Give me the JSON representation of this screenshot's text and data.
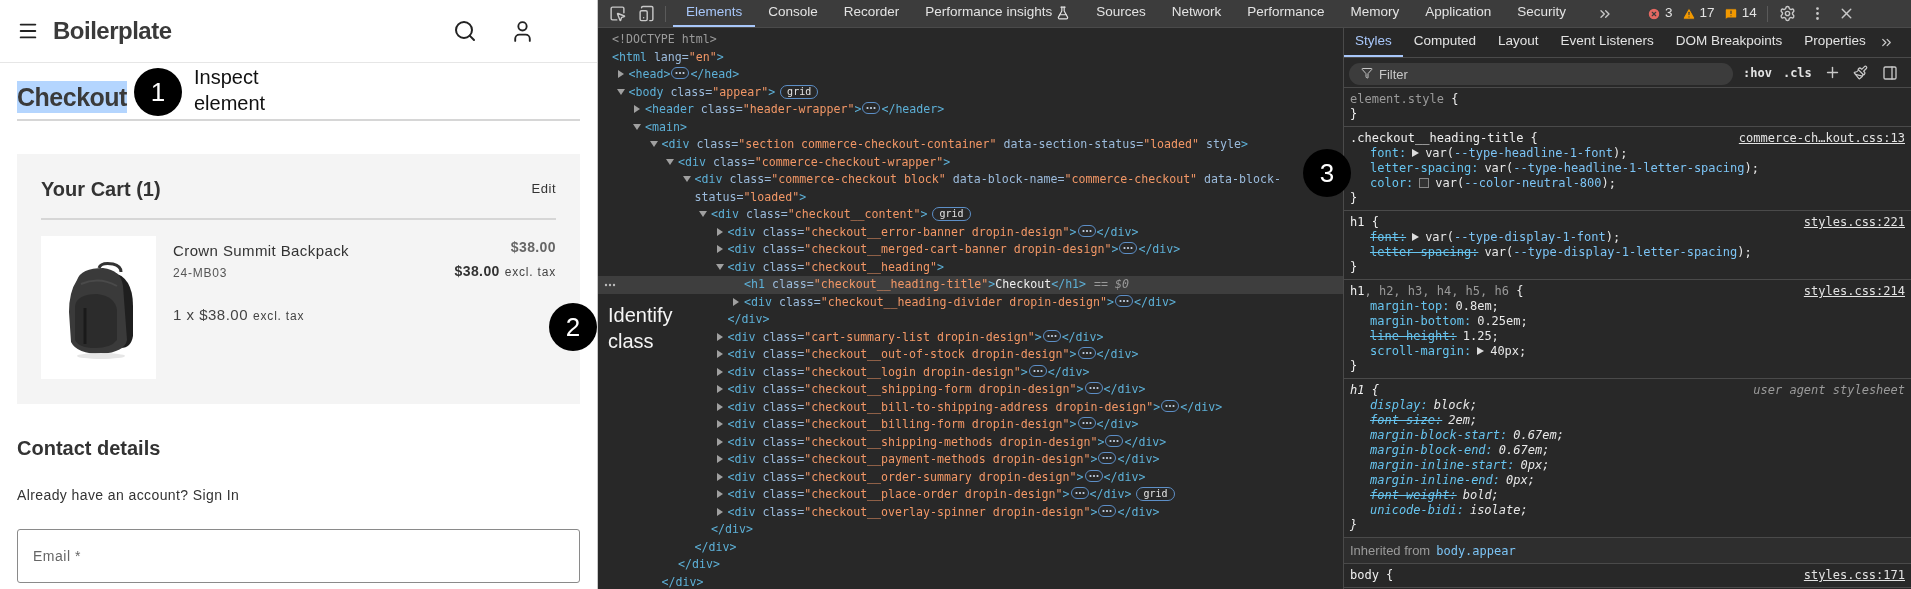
{
  "site": {
    "brand": "Boilerplate"
  },
  "checkout": {
    "title": "Checkout",
    "highlighted": true
  },
  "cart": {
    "title": "Your Cart (1)",
    "edit": "Edit",
    "items": [
      {
        "name": "Crown Summit Backpack",
        "sku": "24-MB03",
        "quantity": "1 x $38.00",
        "quantity_note": "excl. tax",
        "price": "$38.00",
        "price_excl": "$38.00",
        "price_excl_note": "excl. tax"
      }
    ]
  },
  "contact": {
    "title": "Contact details",
    "prompt": "Already have an account? Sign In",
    "email": {
      "placeholder": "Email *"
    }
  },
  "devtools": {
    "tabs": [
      {
        "label": "Elements",
        "selected": true
      },
      {
        "label": "Console",
        "selected": false
      },
      {
        "label": "Recorder",
        "selected": false
      },
      {
        "label": "Performance insights",
        "selected": false,
        "experimental": true
      },
      {
        "label": "Sources",
        "selected": false
      },
      {
        "label": "Network",
        "selected": false
      },
      {
        "label": "Performance",
        "selected": false
      },
      {
        "label": "Memory",
        "selected": false
      },
      {
        "label": "Application",
        "selected": false
      },
      {
        "label": "Security",
        "selected": false
      }
    ],
    "counts": {
      "errors": "3",
      "warnings": "17",
      "issues": "14"
    },
    "tree": [
      {
        "kind": "doctype",
        "text": "<!DOCTYPE html>"
      },
      {
        "kind": "root",
        "open": "<html lang=\"en\">",
        "selected": false,
        "children": [
          {
            "kind": "element",
            "open": "<head>",
            "close": "</head>",
            "expanded": false,
            "selected": false
          },
          {
            "kind": "element",
            "open": "<body class=\"appear\">",
            "badge": "grid",
            "expanded": true,
            "selected": false,
            "children": [
              {
                "kind": "element",
                "open": "<header class=\"header-wrapper\">",
                "close": "</header>",
                "expanded": false,
                "selected": false
              },
              {
                "kind": "element",
                "open": "<main>",
                "expanded": true,
                "selected": false,
                "children": [
                  {
                    "kind": "element",
                    "open": "<div class=\"section commerce-checkout-container\" data-section-status=\"loaded\" style>",
                    "close": "</div>",
                    "expanded": true,
                    "selected": false,
                    "children": [
                      {
                        "kind": "element",
                        "open": "<div class=\"commerce-checkout-wrapper\">",
                        "close": "</div>",
                        "expanded": true,
                        "selected": false,
                        "children": [
                          {
                            "kind": "element",
                            "open": "<div class=\"commerce-checkout block\" data-block-name=\"commerce-checkout\" data-block-status=\"loaded\">",
                            "close": "</div>",
                            "expanded": true,
                            "selected": false,
                            "children": [
                              {
                                "kind": "element",
                                "open": "<div class=\"checkout__content\">",
                                "badge": "grid",
                                "close": "</div>",
                                "expanded": true,
                                "selected": false,
                                "children": [
                                  {
                                    "kind": "element",
                                    "open": "<div class=\"checkout__error-banner dropin-design\">",
                                    "close": "</div>",
                                    "expanded": false,
                                    "selected": false
                                  },
                                  {
                                    "kind": "element",
                                    "open": "<div class=\"checkout__merged-cart-banner dropin-design\">",
                                    "close": "</div>",
                                    "expanded": false,
                                    "selected": false
                                  },
                                  {
                                    "kind": "element",
                                    "open": "<div class=\"checkout__heading\">",
                                    "close": "</div>",
                                    "expanded": true,
                                    "selected": false,
                                    "children": [
                                      {
                                        "kind": "inline",
                                        "open": "<h1 class=\"checkout__heading-title\">",
                                        "text": "Checkout",
                                        "close": "</h1>",
                                        "suffix": "== $0",
                                        "selected": true
                                      },
                                      {
                                        "kind": "element",
                                        "open": "<div class=\"checkout__heading-divider dropin-design\">",
                                        "close": "</div>",
                                        "expanded": false,
                                        "selected": false
                                      }
                                    ]
                                  },
                                  {
                                    "kind": "element",
                                    "open": "<div class=\"cart-summary-list dropin-design\">",
                                    "close": "</div>",
                                    "expanded": false,
                                    "selected": false
                                  },
                                  {
                                    "kind": "element",
                                    "open": "<div class=\"checkout__out-of-stock dropin-design\">",
                                    "close": "</div>",
                                    "expanded": false,
                                    "selected": false
                                  },
                                  {
                                    "kind": "element",
                                    "open": "<div class=\"checkout__login dropin-design\">",
                                    "close": "</div>",
                                    "expanded": false,
                                    "selected": false
                                  },
                                  {
                                    "kind": "element",
                                    "open": "<div class=\"checkout__shipping-form dropin-design\">",
                                    "close": "</div>",
                                    "expanded": false,
                                    "selected": false
                                  },
                                  {
                                    "kind": "element",
                                    "open": "<div class=\"checkout__bill-to-shipping-address dropin-design\">",
                                    "close": "</div>",
                                    "expanded": false,
                                    "selected": false
                                  },
                                  {
                                    "kind": "element",
                                    "open": "<div class=\"checkout__billing-form dropin-design\">",
                                    "close": "</div>",
                                    "expanded": false,
                                    "selected": false
                                  },
                                  {
                                    "kind": "element",
                                    "open": "<div class=\"checkout__shipping-methods dropin-design\">",
                                    "close": "</div>",
                                    "expanded": false,
                                    "selected": false
                                  },
                                  {
                                    "kind": "element",
                                    "open": "<div class=\"checkout__payment-methods dropin-design\">",
                                    "close": "</div>",
                                    "expanded": false,
                                    "selected": false
                                  },
                                  {
                                    "kind": "element",
                                    "open": "<div class=\"checkout__order-summary dropin-design\">",
                                    "close": "</div>",
                                    "expanded": false,
                                    "selected": false
                                  },
                                  {
                                    "kind": "element",
                                    "open": "<div class=\"checkout__place-order dropin-design\">",
                                    "close": "</div>",
                                    "badge": "grid",
                                    "expanded": false,
                                    "selected": false
                                  },
                                  {
                                    "kind": "element",
                                    "open": "<div class=\"checkout__overlay-spinner dropin-design\">",
                                    "close": "</div>",
                                    "expanded": false,
                                    "selected": false
                                  }
                                ]
                              }
                            ]
                          }
                        ]
                      }
                    ]
                  }
                ]
              }
            ]
          }
        ]
      }
    ],
    "styles": {
      "tabs": [
        {
          "label": "Styles",
          "selected": true
        },
        {
          "label": "Computed",
          "selected": false
        },
        {
          "label": "Layout",
          "selected": false
        },
        {
          "label": "Event Listeners",
          "selected": false
        },
        {
          "label": "DOM Breakpoints",
          "selected": false
        },
        {
          "label": "Properties",
          "selected": false
        }
      ],
      "filter": {
        "placeholder": "Filter"
      },
      "hov": ":hov",
      "cls": ".cls",
      "rules": [
        {
          "kind": "rule",
          "selector": [
            {
              "text": "element.style",
              "dim": true
            },
            {
              "text": " {",
              "dim": false
            }
          ],
          "close": "}",
          "italic": false
        },
        {
          "kind": "rule",
          "selector": [
            {
              "text": ".checkout__heading-title {",
              "dim": false
            }
          ],
          "source": "commerce-ch…kout.css:13",
          "source_link": true,
          "close": "}",
          "italic": false,
          "declarations": [
            {
              "property": "font:",
              "value": "var(--type-headline-1-font);",
              "expander": true,
              "swatch": false,
              "struck": false
            },
            {
              "property": "letter-spacing:",
              "value": "var(--type-headline-1-letter-spacing);",
              "expander": false,
              "swatch": false,
              "struck": false
            },
            {
              "property": "color:",
              "value": "var(--color-neutral-800);",
              "expander": false,
              "swatch": true,
              "struck": false
            }
          ]
        },
        {
          "kind": "rule",
          "selector": [
            {
              "text": "h1 {",
              "dim": false
            }
          ],
          "source": "styles.css:221",
          "source_link": true,
          "close": "}",
          "italic": false,
          "declarations": [
            {
              "property": "font:",
              "value": "var(--type-display-1-font);",
              "expander": true,
              "swatch": false,
              "struck": true
            },
            {
              "property": "letter-spacing:",
              "value": "var(--type-display-1-letter-spacing);",
              "expander": false,
              "swatch": false,
              "struck": true
            }
          ]
        },
        {
          "kind": "rule",
          "selector": [
            {
              "text": "h1",
              "dim": false
            },
            {
              "text": ", h2, h3, h4, h5, h6",
              "dim": true
            },
            {
              "text": " {",
              "dim": false
            }
          ],
          "source": "styles.css:214",
          "source_link": true,
          "close": "}",
          "italic": false,
          "declarations": [
            {
              "property": "margin-top:",
              "value": "0.8em;",
              "expander": false,
              "swatch": false,
              "struck": false
            },
            {
              "property": "margin-bottom:",
              "value": "0.25em;",
              "expander": false,
              "swatch": false,
              "struck": false
            },
            {
              "property": "line-height:",
              "value": "1.25;",
              "expander": false,
              "swatch": false,
              "struck": true
            },
            {
              "property": "scroll-margin:",
              "value": "40px;",
              "expander": true,
              "swatch": false,
              "struck": false
            }
          ]
        },
        {
          "kind": "rule",
          "selector": [
            {
              "text": "h1 {",
              "dim": false
            }
          ],
          "source": "user agent stylesheet",
          "source_link": false,
          "close": "}",
          "italic": true,
          "declarations": [
            {
              "property": "display:",
              "value": "block;",
              "expander": false,
              "swatch": false,
              "struck": false
            },
            {
              "property": "font-size:",
              "value": "2em;",
              "expander": false,
              "swatch": false,
              "struck": true
            },
            {
              "property": "margin-block-start:",
              "value": "0.67em;",
              "expander": false,
              "swatch": false,
              "struck": false
            },
            {
              "property": "margin-block-end:",
              "value": "0.67em;",
              "expander": false,
              "swatch": false,
              "struck": false
            },
            {
              "property": "margin-inline-start:",
              "value": "0px;",
              "expander": false,
              "swatch": false,
              "struck": false
            },
            {
              "property": "margin-inline-end:",
              "value": "0px;",
              "expander": false,
              "swatch": false,
              "struck": false
            },
            {
              "property": "font-weight:",
              "value": "bold;",
              "expander": false,
              "swatch": false,
              "struck": true
            },
            {
              "property": "unicode-bidi:",
              "value": "isolate;",
              "expander": false,
              "swatch": false,
              "struck": false
            }
          ]
        },
        {
          "kind": "inherited",
          "label": "Inherited from",
          "link": "body.appear"
        },
        {
          "kind": "rule",
          "selector": [
            {
              "text": "body {",
              "dim": false
            }
          ],
          "source": "styles.css:171",
          "source_link": true,
          "italic": false
        }
      ]
    }
  },
  "annotations": [
    {
      "number": "1",
      "label": "Inspect element"
    },
    {
      "number": "2",
      "label": "Identify class"
    },
    {
      "number": "3"
    }
  ]
}
